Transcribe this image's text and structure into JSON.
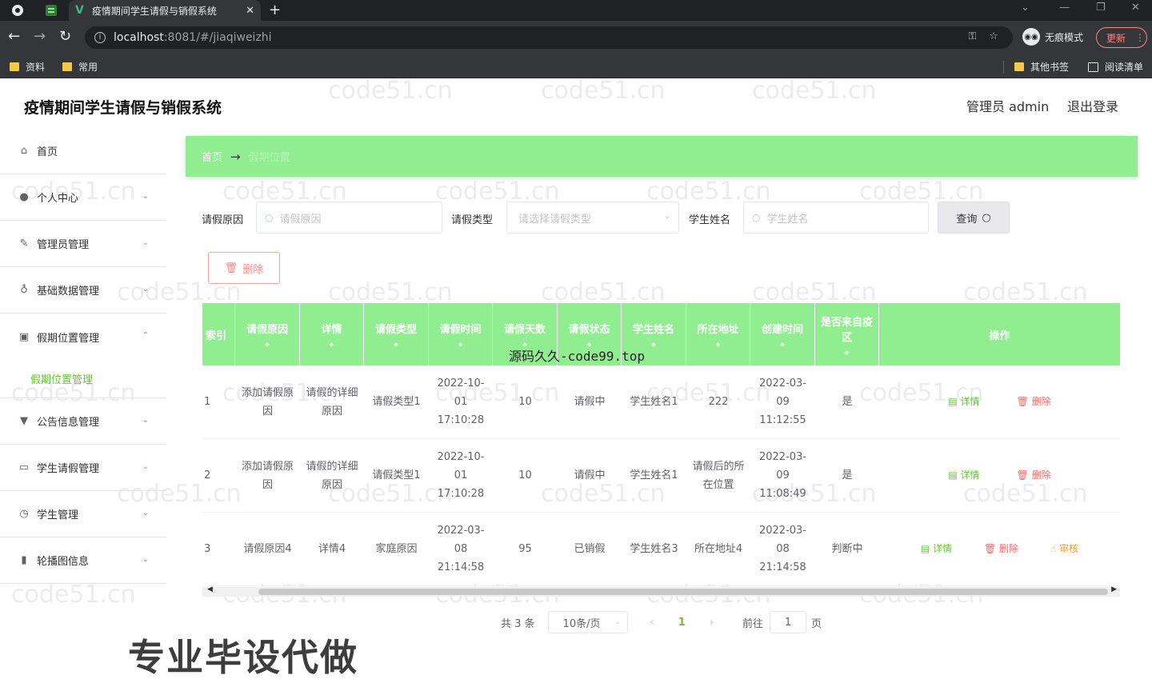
{
  "browser": {
    "tab_title": "疫情期间学生请假与销假系统",
    "url_host": "localhost",
    "url_rest": ":8081/#/jiaqiweizhi",
    "incognito_label": "无痕模式",
    "update_label": "更新",
    "bookmarks": [
      "资料",
      "常用"
    ],
    "other_bookmarks": "其他书签",
    "reading_list": "阅读清单"
  },
  "header": {
    "title": "疫情期间学生请假与销假系统",
    "user": "管理员 admin",
    "logout": "退出登录"
  },
  "sidebar": {
    "items": [
      {
        "label": "首页",
        "icon": "home-icon"
      },
      {
        "label": "个人中心",
        "icon": "user-icon"
      },
      {
        "label": "管理员管理",
        "icon": "edit-icon"
      },
      {
        "label": "基础数据管理",
        "icon": "mic-icon"
      },
      {
        "label": "假期位置管理",
        "icon": "chat-icon"
      },
      {
        "label": "公告信息管理",
        "icon": "stamp-icon"
      },
      {
        "label": "学生请假管理",
        "icon": "message-icon"
      },
      {
        "label": "学生管理",
        "icon": "clock-icon"
      },
      {
        "label": "轮播图信息",
        "icon": "chart-icon"
      }
    ],
    "active_sub": "假期位置管理"
  },
  "breadcrumb": {
    "home": "首页",
    "arrow": "→",
    "current": "假期位置"
  },
  "search": {
    "reason_label": "请假原因",
    "reason_placeholder": "请假原因",
    "type_label": "请假类型",
    "type_placeholder": "请选择请假类型",
    "name_label": "学生姓名",
    "name_placeholder": "学生姓名",
    "query_label": "查询"
  },
  "actions": {
    "delete_label": "删除"
  },
  "table": {
    "headers": [
      "索引",
      "请假原因",
      "详情",
      "请假类型",
      "请假时间",
      "请假天数",
      "请假状态",
      "学生姓名",
      "所在地址",
      "创建时间",
      "是否来自疫区",
      "操作"
    ],
    "rows": [
      {
        "idx": "1",
        "reason": "添加请假原因",
        "detail": "请假的详细原因",
        "type": "请假类型1",
        "time": "2022-10-01 17:10:28",
        "days": "10",
        "status": "请假中",
        "name": "学生姓名1",
        "address": "222",
        "created": "2022-03-09 11:12:55",
        "epidemic": "是",
        "ops": [
          "详情",
          "删除"
        ]
      },
      {
        "idx": "2",
        "reason": "添加请假原因",
        "detail": "请假的详细原因",
        "type": "请假类型1",
        "time": "2022-10-01 17:10:28",
        "days": "10",
        "status": "请假中",
        "name": "学生姓名1",
        "address": "请假后的所在位置",
        "created": "2022-03-09 11:08:49",
        "epidemic": "是",
        "ops": [
          "详情",
          "删除"
        ]
      },
      {
        "idx": "3",
        "reason": "请假原因4",
        "detail": "详情4",
        "type": "家庭原因",
        "time": "2022-03-08 21:14:58",
        "days": "95",
        "status": "已销假",
        "name": "学生姓名3",
        "address": "所在地址4",
        "created": "2022-03-08 21:14:58",
        "epidemic": "判断中",
        "ops": [
          "详情",
          "删除",
          "审核"
        ]
      }
    ]
  },
  "pager": {
    "total": "共 3 条",
    "size": "10条/页",
    "current": "1",
    "goto": "前往",
    "goto_value": "1",
    "page_unit": "页"
  },
  "overlay": {
    "mid_text": "源码久久-code99.top",
    "promo": "专业毕设代做",
    "watermark": "code51.cn"
  },
  "colors": {
    "accent": "#90ee90",
    "green_text": "#67c23a",
    "danger": "#f56c6c",
    "warning": "#e6a23c"
  }
}
